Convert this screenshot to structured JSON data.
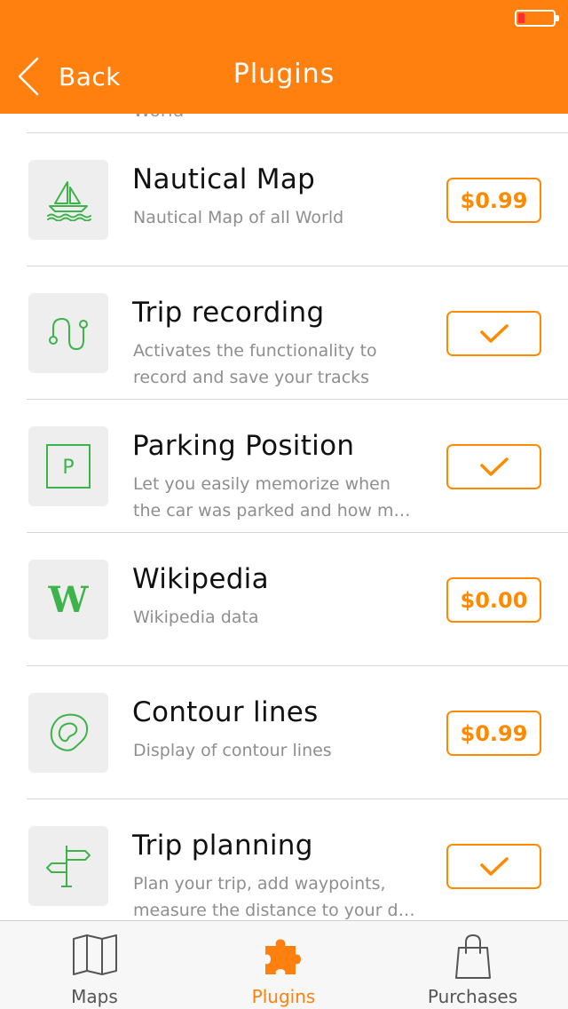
{
  "header": {
    "back_label": "Back",
    "title": "Plugins",
    "accent_color": "#ff7f0f",
    "battery_level_pct": 10
  },
  "list": {
    "cut_off_text": "World",
    "items": [
      {
        "icon": "sailboat-icon",
        "title": "Nautical Map",
        "subtitle_lines": [
          "Nautical Map of all World"
        ],
        "action": "price",
        "action_label": "$0.99"
      },
      {
        "icon": "route-icon",
        "title": "Trip recording",
        "subtitle_lines": [
          "Activates the functionality to",
          "record and save your tracks"
        ],
        "action": "check",
        "action_label": ""
      },
      {
        "icon": "parking-icon",
        "title": "Parking Position",
        "subtitle_lines": [
          "Let you easily memorize when",
          "the car was parked and how m…"
        ],
        "action": "check",
        "action_label": ""
      },
      {
        "icon": "wikipedia-icon",
        "title": "Wikipedia",
        "subtitle_lines": [
          "Wikipedia data"
        ],
        "action": "price",
        "action_label": "$0.00"
      },
      {
        "icon": "contour-icon",
        "title": "Contour lines",
        "subtitle_lines": [
          "Display of contour lines"
        ],
        "action": "price",
        "action_label": "$0.99"
      },
      {
        "icon": "signpost-icon",
        "title": "Trip planning",
        "subtitle_lines": [
          "Plan your trip, add waypoints,",
          "measure the distance to your d…"
        ],
        "action": "check",
        "action_label": ""
      }
    ]
  },
  "tabbar": {
    "tabs": [
      {
        "label": "Maps",
        "icon": "map-icon",
        "active": false
      },
      {
        "label": "Plugins",
        "icon": "puzzle-icon",
        "active": true
      },
      {
        "label": "Purchases",
        "icon": "shopping-bag-icon",
        "active": false
      }
    ]
  },
  "colors": {
    "accent": "#ff7f0f",
    "icon_green": "#3db34a",
    "price_orange": "#ff8a00"
  }
}
